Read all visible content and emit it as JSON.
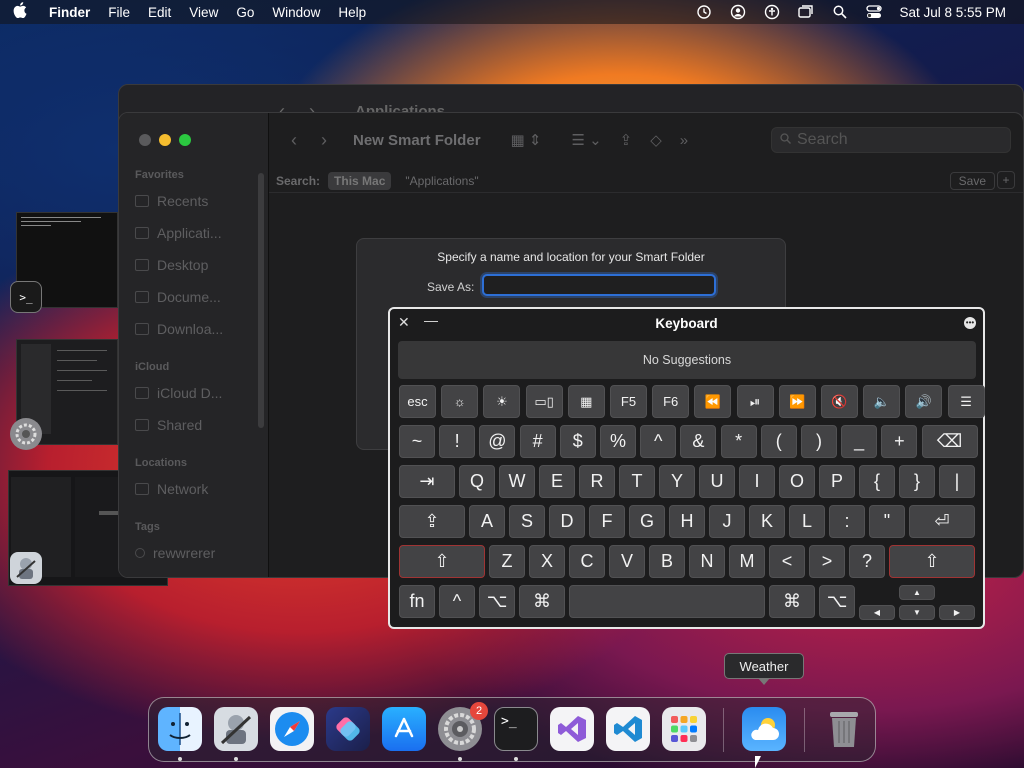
{
  "menubar": {
    "app_name": "Finder",
    "menus": [
      "File",
      "Edit",
      "View",
      "Go",
      "Window",
      "Help"
    ],
    "datetime": "Sat Jul 8  5:55 PM",
    "status_icons": [
      "time-machine-icon",
      "user-icon",
      "accessibility-icon",
      "screen-mirroring-icon",
      "spotlight-icon",
      "control-center-icon"
    ]
  },
  "back_window": {
    "title": "Applications"
  },
  "finder": {
    "title": "New Smart Folder",
    "search_placeholder": "Search",
    "sidebar": {
      "favorites_label": "Favorites",
      "favorites": [
        "Recents",
        "Applicati...",
        "Desktop",
        "Docume...",
        "Downloa..."
      ],
      "icloud_label": "iCloud",
      "icloud": [
        "iCloud D...",
        "Shared"
      ],
      "locations_label": "Locations",
      "locations": [
        "Network"
      ],
      "tags_label": "Tags",
      "tags": [
        "rewwrerer"
      ]
    },
    "scope": {
      "label": "Search:",
      "this_mac": "This Mac",
      "applications": "\"Applications\"",
      "save": "Save",
      "plus": "+"
    }
  },
  "sheet": {
    "prompt": "Specify a name and location for your Smart Folder",
    "save_as_label": "Save As:",
    "save_as_value": ""
  },
  "keyboard": {
    "title": "Keyboard",
    "suggestions": "No Suggestions",
    "row0": [
      "esc",
      "☼",
      "☀",
      "▭▯",
      "▦",
      "F5",
      "F6",
      "⏪",
      "⏯",
      "⏩",
      "🔇",
      "🔈",
      "🔊",
      "☰"
    ],
    "row1": [
      "~",
      "!",
      "@",
      "#",
      "$",
      "%",
      "^",
      "&",
      "*",
      "(",
      ")",
      "_",
      "+",
      "⌫"
    ],
    "row2": [
      "⇥",
      "Q",
      "W",
      "E",
      "R",
      "T",
      "Y",
      "U",
      "I",
      "O",
      "P",
      "{",
      "}",
      "|"
    ],
    "row3": [
      "⇪",
      "A",
      "S",
      "D",
      "F",
      "G",
      "H",
      "J",
      "K",
      "L",
      ":",
      "\"",
      "⏎"
    ],
    "row4": [
      "⇧",
      "Z",
      "X",
      "C",
      "V",
      "B",
      "N",
      "M",
      "<",
      ">",
      "?",
      "⇧"
    ],
    "row5": [
      "fn",
      "^",
      "⌥",
      "⌘",
      "",
      "⌘",
      "⌥"
    ],
    "arrows": [
      "▲",
      "◀",
      "▼",
      "▶"
    ]
  },
  "tooltip": {
    "text": "Weather"
  },
  "dock": {
    "apps": [
      {
        "name": "Finder",
        "running": true
      },
      {
        "name": "Automator",
        "running": true
      },
      {
        "name": "Safari",
        "running": false
      },
      {
        "name": "Shortcuts",
        "running": false
      },
      {
        "name": "App Store",
        "running": false
      },
      {
        "name": "System Settings",
        "running": true,
        "badge": "2"
      },
      {
        "name": "Terminal",
        "running": true
      },
      {
        "name": "Visual Studio",
        "running": false
      },
      {
        "name": "Visual Studio Code",
        "running": false
      },
      {
        "name": "Launchpad",
        "running": false
      },
      {
        "name": "Weather",
        "running": false
      },
      {
        "name": "Trash",
        "running": false
      }
    ]
  }
}
